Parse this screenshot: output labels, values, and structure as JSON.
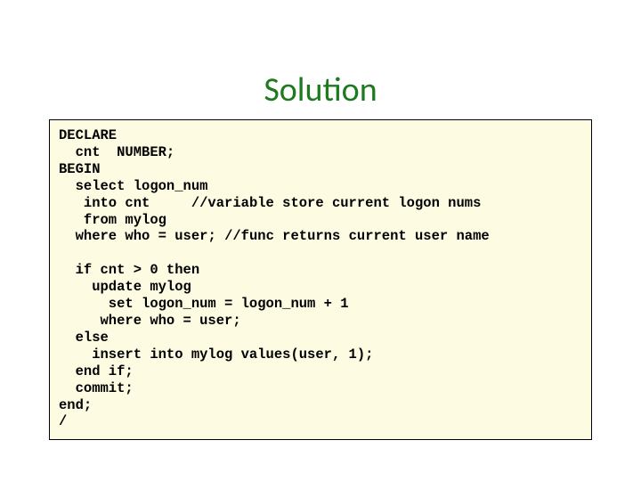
{
  "title": "Solution",
  "code": {
    "l1": "DECLARE",
    "l2": "  cnt  NUMBER;",
    "l3": "BEGIN",
    "l4": "  select logon_num",
    "l5a": "   into cnt     ",
    "l5b": "//variable store current logon nums",
    "l6": "   from mylog",
    "l7a": "  where who = ",
    "l7b": "user",
    "l7c": "; ",
    "l7d": "//func returns current user name",
    "l8": "",
    "l9": "  if cnt > 0 then",
    "l10": "    update mylog",
    "l11": "      set logon_num = logon_num + 1",
    "l12": "     where who = user;",
    "l13": "  else",
    "l14": "    insert into mylog values(user, 1);",
    "l15": "  end if;",
    "l16": "  commit;",
    "l17": "end;",
    "l18": "/"
  }
}
